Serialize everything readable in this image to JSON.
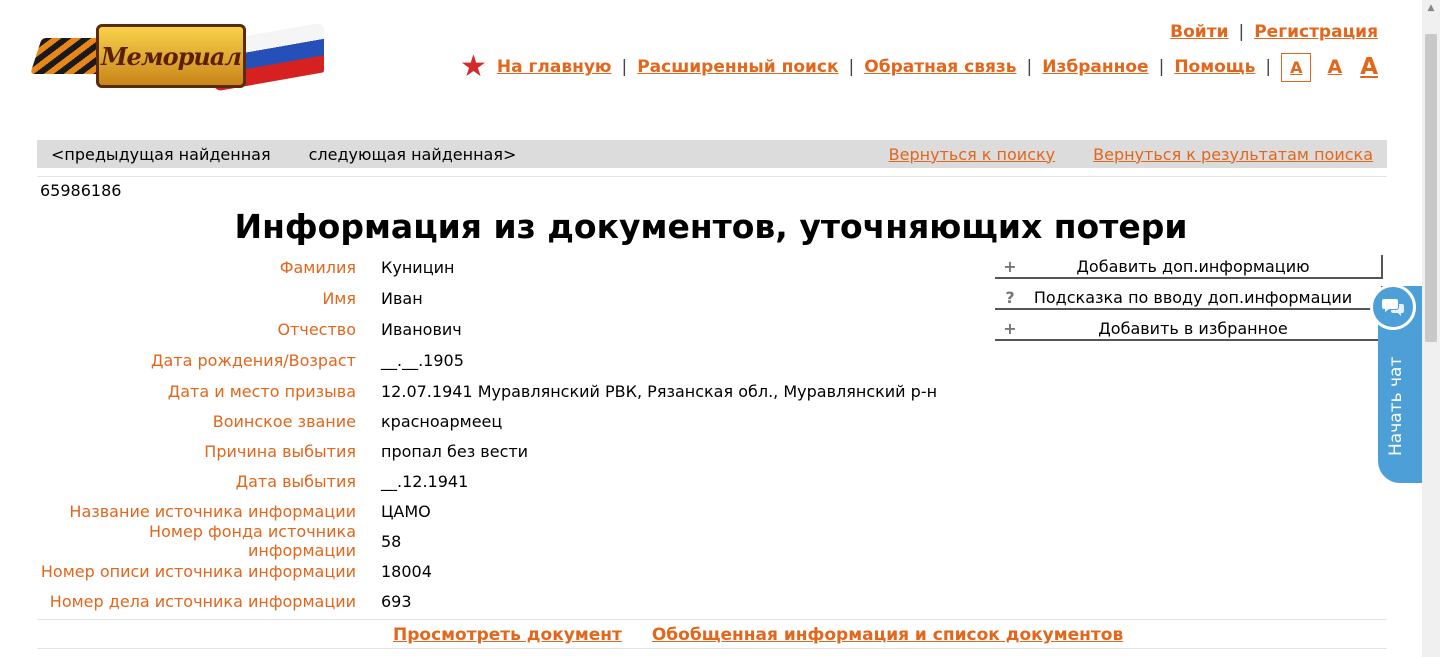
{
  "logo": {
    "text": "Мемориал"
  },
  "auth": {
    "login": "Войти",
    "separator": "|",
    "register": "Регистрация"
  },
  "nav": {
    "home": "На главную",
    "advanced_search": "Расширенный поиск",
    "feedback": "Обратная связь",
    "favorites": "Избранное",
    "help": "Помощь",
    "font_small": "А",
    "font_medium": "А",
    "font_large": "А"
  },
  "navbar": {
    "prev": "<предыдущая найденная",
    "next": "следующая найденная>",
    "back_to_search": "Вернуться к поиску",
    "back_to_results": "Вернуться к результатам поиска"
  },
  "record_id": "65986186",
  "page_title": "Информация из документов, уточняющих потери",
  "info": [
    {
      "label": "Фамилия",
      "value": "Куницин"
    },
    {
      "label": "Имя",
      "value": "Иван"
    },
    {
      "label": "Отчество",
      "value": "Иванович"
    },
    {
      "label": "Дата рождения/Возраст",
      "value": "__.__.1905"
    },
    {
      "label": "Дата и место призыва",
      "value": "12.07.1941 Муравлянский РВК, Рязанская обл., Муравлянский р-н"
    },
    {
      "label": "Воинское звание",
      "value": "красноармеец"
    },
    {
      "label": "Причина выбытия",
      "value": "пропал без вести"
    },
    {
      "label": "Дата выбытия",
      "value": "__.12.1941"
    },
    {
      "label": "Название источника информации",
      "value": "ЦАМО"
    },
    {
      "label": "Номер фонда источника информации",
      "value": "58"
    },
    {
      "label": "Номер описи источника информации",
      "value": "18004"
    },
    {
      "label": "Номер дела источника информации",
      "value": "693"
    }
  ],
  "actions": {
    "add_info": {
      "icon": "+",
      "label": "Добавить доп.информацию"
    },
    "hint": {
      "icon": "?",
      "label": "Подсказка по вводу доп.информации"
    },
    "add_favorite": {
      "icon": "+",
      "label": "Добавить в избранное"
    }
  },
  "bottom": {
    "view_document": "Просмотреть документ",
    "summary": "Обобщенная информация и список документов"
  },
  "chat": {
    "label": "Начать чат"
  },
  "colors": {
    "accent": "#e2661c",
    "chat": "#4d9fd8",
    "navbar_bg": "#dcdcdc"
  }
}
